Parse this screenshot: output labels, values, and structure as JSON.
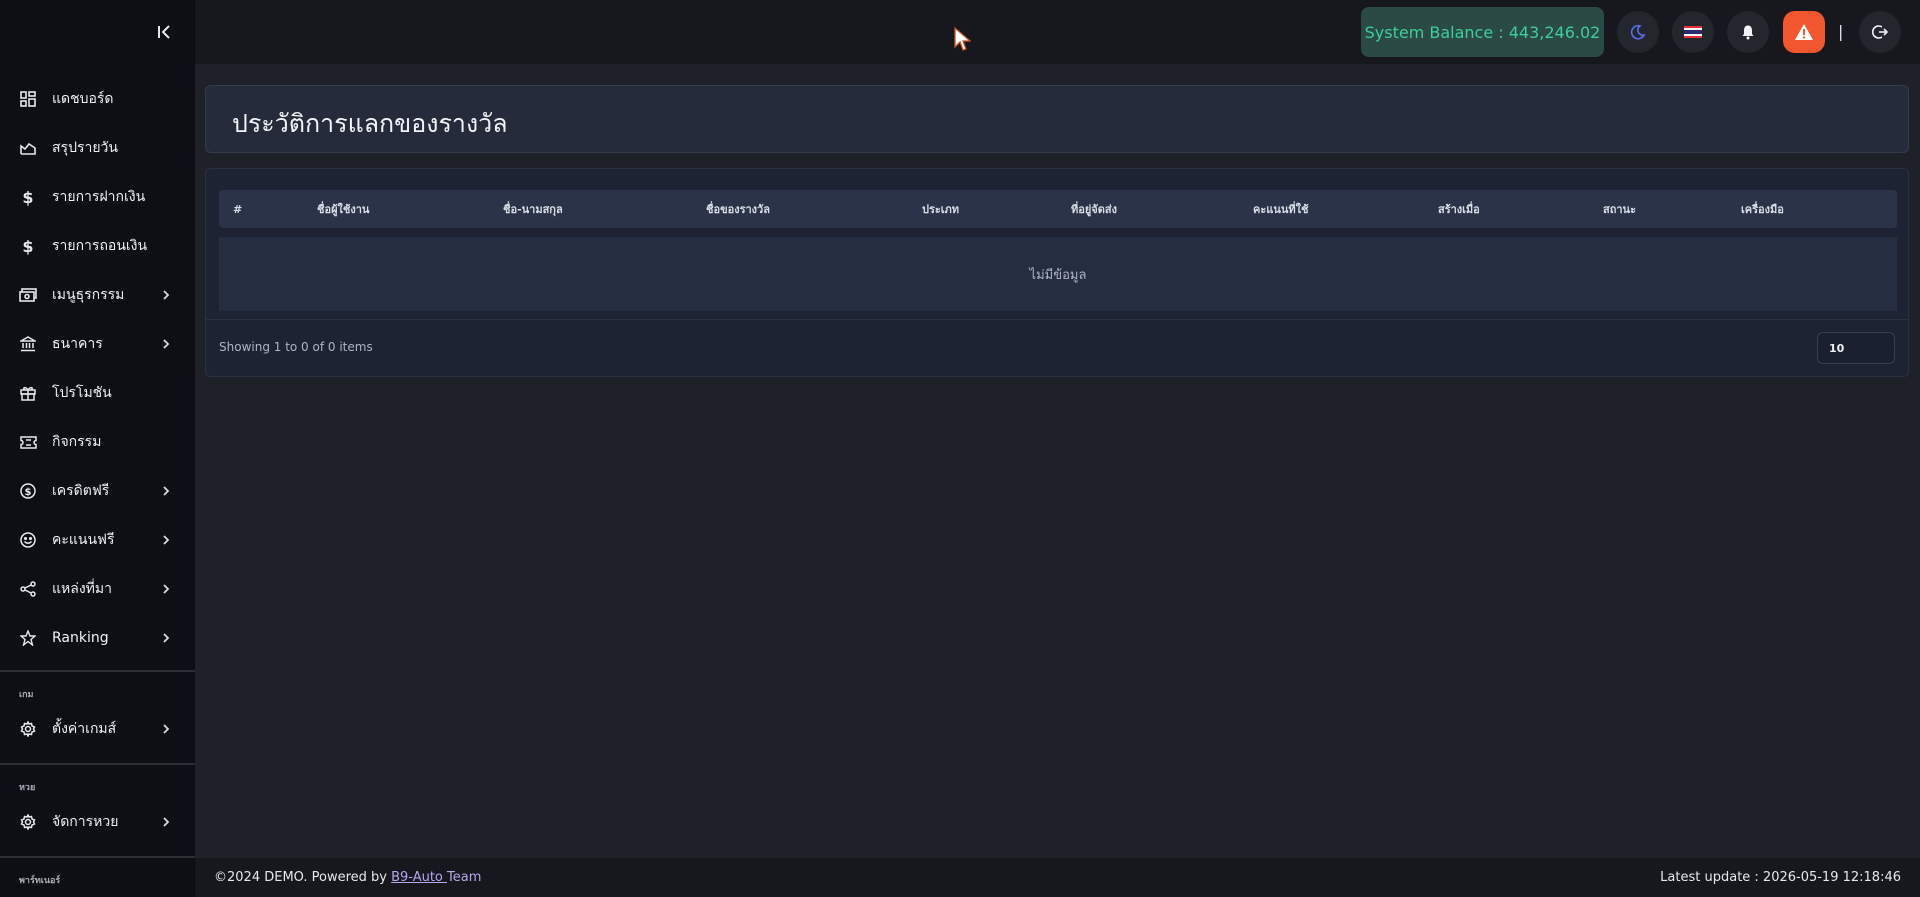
{
  "sidebar": {
    "items": [
      {
        "label": "แดชบอร์ด",
        "icon": "dashboard-icon",
        "has_submenu": false
      },
      {
        "label": "สรุปรายวัน",
        "icon": "chart-area-icon",
        "has_submenu": false
      },
      {
        "label": "รายการฝากเงิน",
        "icon": "dollar-icon",
        "has_submenu": false
      },
      {
        "label": "รายการถอนเงิน",
        "icon": "dollar-icon",
        "has_submenu": false
      },
      {
        "label": "เมนูธุรกรรม",
        "icon": "cash-icon",
        "has_submenu": true
      },
      {
        "label": "ธนาคาร",
        "icon": "bank-icon",
        "has_submenu": true
      },
      {
        "label": "โปรโมชัน",
        "icon": "gift-icon",
        "has_submenu": false
      },
      {
        "label": "กิจกรรม",
        "icon": "ticket-icon",
        "has_submenu": false
      },
      {
        "label": "เครดิตฟรี",
        "icon": "coin-icon",
        "has_submenu": true
      },
      {
        "label": "คะแนนฟรี",
        "icon": "smiley-icon",
        "has_submenu": true
      },
      {
        "label": "แหล่งที่มา",
        "icon": "share-icon",
        "has_submenu": true
      },
      {
        "label": "Ranking",
        "icon": "star-icon",
        "has_submenu": true
      }
    ],
    "sections": [
      {
        "label": "เกม",
        "items": [
          {
            "label": "ตั้งค่าเกมส์",
            "icon": "gear-icon",
            "has_submenu": true
          }
        ]
      },
      {
        "label": "หวย",
        "items": [
          {
            "label": "จัดการหวย",
            "icon": "gear-icon",
            "has_submenu": true
          }
        ]
      },
      {
        "label": "พาร์ทเนอร์",
        "items": []
      }
    ]
  },
  "topbar": {
    "balance_label": "System Balance : 443,246.02",
    "theme_icon": "moon-icon",
    "language_icon": "thai-flag-icon",
    "notification_icon": "bell-icon",
    "alert_icon": "warning-icon",
    "separator": "|",
    "logout_icon": "logout-icon"
  },
  "page": {
    "title": "ประวัติการแลกของรางวัล"
  },
  "table": {
    "columns": [
      "#",
      "ชื่อผู้ใช้งาน",
      "ชื่อ-นามสกุล",
      "ชื่อของรางวัล",
      "ประเภท",
      "ที่อยู่จัดส่ง",
      "คะแนนที่ใช้",
      "สร้างเมื่อ",
      "สถานะ",
      "เครื่องมือ"
    ],
    "empty_text": "ไม่มีข้อมูล",
    "showing_text": "Showing 1 to 0 of 0 items",
    "page_size": "10"
  },
  "footer": {
    "copyright": "©2024 DEMO. Powered by ",
    "link_text": "B9-Auto ",
    "team_text": "Team",
    "last_update": "Latest update : 2026-05-19 12:18:46"
  },
  "colors": {
    "sidebar_bg": "#0d0f14",
    "content_bg": "#1f2129",
    "balance_bg": "#2b4a45",
    "balance_text": "#3ccf9a",
    "alert_bg": "#f2572f",
    "link": "#b7a6f0"
  }
}
